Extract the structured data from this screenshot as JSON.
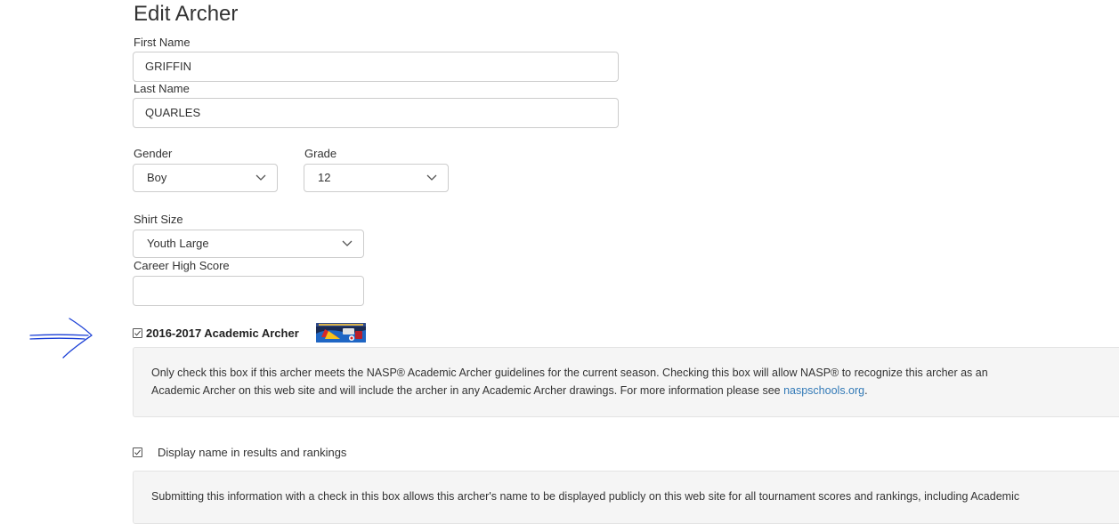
{
  "form": {
    "title": "Edit Archer",
    "first_name": {
      "label": "First Name",
      "value": "GRIFFIN"
    },
    "last_name": {
      "label": "Last Name",
      "value": "QUARLES"
    },
    "gender": {
      "label": "Gender",
      "value": "Boy"
    },
    "grade": {
      "label": "Grade",
      "value": "12"
    },
    "shirt_size": {
      "label": "Shirt Size",
      "value": "Youth Large"
    },
    "career_high": {
      "label": "Career High Score",
      "value": ""
    }
  },
  "academic": {
    "checked": true,
    "label": "2016-2017 Academic Archer",
    "note_line1": "Only check this box if this archer meets the NASP® Academic Archer guidelines for the current season. Checking this box will allow NASP® to recognize this archer as an",
    "note_line2_pre": "Academic Archer on this web site and will include the archer in any Academic Archer drawings. For more information please see ",
    "note_link": "naspschools.org",
    "note_line2_post": "."
  },
  "display_name": {
    "checked": true,
    "label": "Display name in results and rankings",
    "note_line1": "Submitting this information with a check in this box allows this archer's name to be displayed publicly on this web site for all tournament scores and rankings, including Academic"
  },
  "colors": {
    "link": "#337ab7",
    "annotation": "#1a3fd6",
    "well_bg": "#f5f5f5",
    "border": "#cccccc"
  },
  "icons": {
    "select_arrow": "chevron-down-icon",
    "checkbox_mark": "check-icon",
    "annotation": "hand-drawn-arrow-icon",
    "badge": "academic-archer-badge-icon"
  }
}
